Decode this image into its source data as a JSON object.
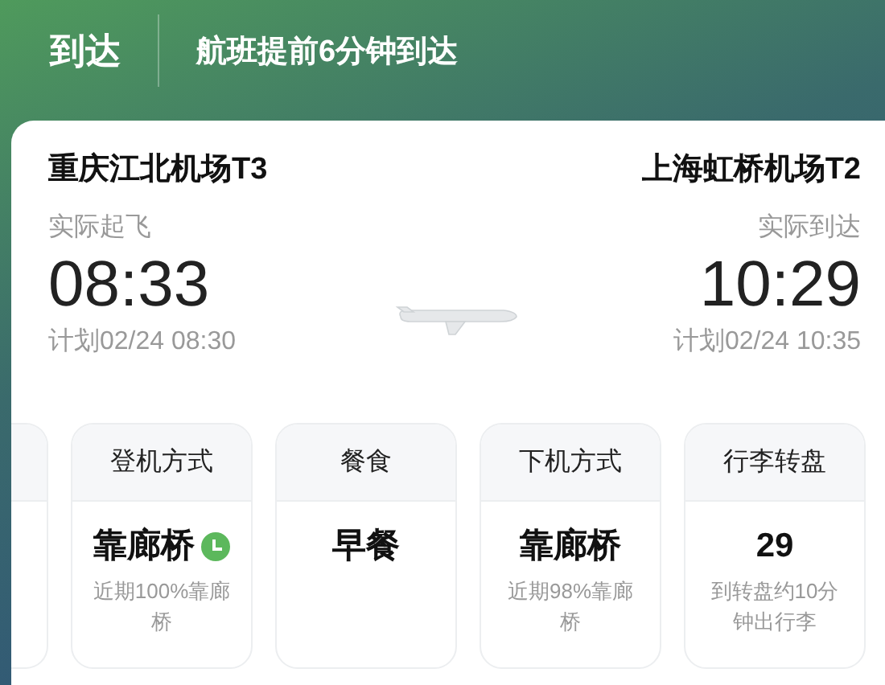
{
  "header": {
    "title": "到达",
    "status": "航班提前6分钟到达"
  },
  "departure": {
    "airport": "重庆江北机场T3",
    "label": "实际起飞",
    "time": "08:33",
    "planned": "计划02/24 08:30"
  },
  "arrival": {
    "airport": "上海虹桥机场T2",
    "label": "实际到达",
    "time": "10:29",
    "planned": "计划02/24 10:35"
  },
  "tiles": [
    {
      "title": "登机方式",
      "value": "靠廊桥",
      "note": "近期100%靠廊桥",
      "clock": true
    },
    {
      "title": "餐食",
      "value": "早餐",
      "clock": false
    },
    {
      "title": "下机方式",
      "value": "靠廊桥",
      "note": "近期98%靠廊桥",
      "clock": false
    },
    {
      "title": "行李转盘",
      "value": "29",
      "note": "到转盘约10分钟出行李",
      "clock": false
    }
  ]
}
